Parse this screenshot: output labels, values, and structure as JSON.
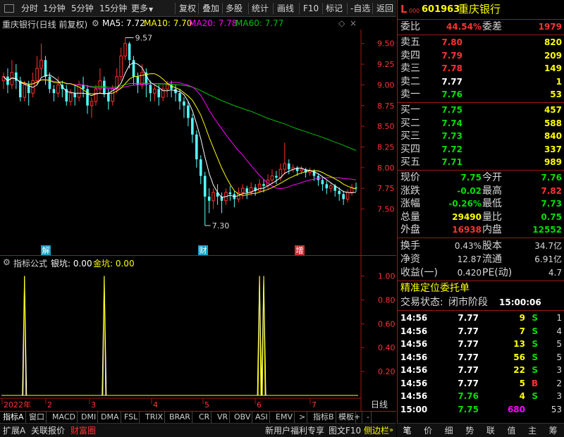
{
  "toolbar": {
    "items": [
      "分时",
      "1分钟",
      "5分钟",
      "15分钟",
      "更多",
      "复权",
      "叠加",
      "多股",
      "统计",
      "画线",
      "F10",
      "标记",
      "-自选",
      "返回"
    ],
    "more_arrow": "▼"
  },
  "chart": {
    "title": "重庆银行(日线 前复权)",
    "ma5": "MA5: 7.72",
    "ma10": "MA10: 7.70",
    "ma20": "MA20: 7.78",
    "ma60": "MA60: 7.77",
    "colors": {
      "ma5": "#ffffff",
      "ma10": "#ffff00",
      "ma20": "#ff00ff",
      "ma60": "#00c000",
      "up": "#ff3232",
      "down": "#54ffff"
    },
    "price_labels": [
      "9.50",
      "9.25",
      "9.00",
      "8.75",
      "8.50",
      "8.25",
      "8.00",
      "7.75",
      "7.50"
    ],
    "high_mark": "9.57",
    "low_mark": "7.30",
    "markers": [
      "解",
      "财",
      "增"
    ]
  },
  "chart_data": {
    "type": "candlestick",
    "ylim": [
      7.3,
      9.6
    ],
    "candles": [
      [
        9.05,
        9.1,
        8.95,
        9.15
      ],
      [
        9.1,
        9.0,
        8.9,
        9.2
      ],
      [
        9.0,
        9.15,
        8.95,
        9.3
      ],
      [
        9.15,
        9.05,
        8.95,
        9.25
      ],
      [
        9.05,
        8.85,
        8.8,
        9.1
      ],
      [
        8.85,
        9.0,
        8.8,
        9.05
      ],
      [
        9.0,
        8.9,
        8.75,
        9.05
      ],
      [
        8.9,
        9.05,
        8.85,
        9.15
      ],
      [
        9.05,
        9.2,
        9.0,
        9.35
      ],
      [
        9.2,
        9.3,
        9.1,
        9.5
      ],
      [
        9.3,
        9.1,
        9.0,
        9.35
      ],
      [
        9.1,
        8.95,
        8.9,
        9.15
      ],
      [
        8.95,
        8.9,
        8.8,
        9.0
      ],
      [
        8.9,
        9.0,
        8.85,
        9.1
      ],
      [
        9.0,
        8.95,
        8.85,
        9.05
      ],
      [
        8.95,
        8.8,
        8.75,
        9.0
      ],
      [
        8.8,
        8.9,
        8.75,
        8.95
      ],
      [
        8.9,
        8.85,
        8.75,
        9.0
      ],
      [
        8.85,
        9.0,
        8.8,
        9.05
      ],
      [
        9.0,
        8.95,
        8.85,
        9.1
      ],
      [
        8.95,
        8.75,
        8.65,
        9.0
      ],
      [
        8.75,
        8.8,
        8.6,
        8.85
      ],
      [
        8.8,
        8.95,
        8.75,
        9.0
      ],
      [
        8.95,
        9.05,
        8.9,
        9.2
      ],
      [
        9.05,
        8.9,
        8.85,
        9.1
      ],
      [
        8.9,
        8.8,
        8.7,
        8.95
      ],
      [
        8.8,
        8.95,
        8.75,
        9.0
      ],
      [
        8.95,
        9.1,
        8.9,
        9.2
      ],
      [
        9.1,
        9.35,
        9.05,
        9.45
      ],
      [
        9.35,
        9.5,
        9.3,
        9.57
      ],
      [
        9.5,
        9.3,
        9.2,
        9.52
      ],
      [
        9.3,
        9.1,
        9.0,
        9.35
      ],
      [
        9.1,
        9.0,
        8.9,
        9.15
      ],
      [
        9.0,
        9.15,
        8.95,
        9.25
      ],
      [
        9.15,
        9.0,
        8.85,
        9.2
      ],
      [
        9.0,
        8.9,
        8.8,
        9.05
      ],
      [
        8.9,
        8.95,
        8.8,
        9.0
      ],
      [
        8.95,
        8.85,
        8.75,
        9.0
      ],
      [
        8.85,
        8.95,
        8.8,
        9.0
      ],
      [
        8.95,
        9.0,
        8.85,
        9.05
      ],
      [
        9.0,
        8.95,
        8.85,
        9.05
      ],
      [
        8.95,
        8.9,
        8.8,
        9.0
      ],
      [
        8.9,
        8.8,
        8.7,
        8.95
      ],
      [
        8.8,
        8.75,
        8.6,
        8.85
      ],
      [
        8.75,
        8.6,
        8.5,
        8.8
      ],
      [
        8.6,
        8.4,
        8.3,
        8.65
      ],
      [
        8.4,
        8.1,
        8.0,
        8.45
      ],
      [
        8.1,
        7.9,
        7.8,
        8.15
      ],
      [
        7.9,
        7.65,
        7.3,
        7.95
      ],
      [
        7.65,
        7.6,
        7.45,
        7.75
      ],
      [
        7.6,
        7.7,
        7.5,
        7.75
      ],
      [
        7.7,
        7.65,
        7.55,
        7.8
      ],
      [
        7.65,
        7.6,
        7.45,
        7.7
      ],
      [
        7.6,
        7.7,
        7.55,
        7.75
      ],
      [
        7.7,
        7.68,
        7.6,
        7.78
      ],
      [
        7.68,
        7.62,
        7.52,
        7.72
      ],
      [
        7.62,
        7.7,
        7.58,
        7.76
      ],
      [
        7.7,
        7.75,
        7.62,
        7.8
      ],
      [
        7.75,
        7.7,
        7.62,
        7.78
      ],
      [
        7.7,
        7.76,
        7.66,
        7.82
      ],
      [
        7.76,
        7.72,
        7.66,
        7.8
      ],
      [
        7.72,
        7.8,
        7.7,
        7.86
      ],
      [
        7.8,
        7.78,
        7.7,
        7.86
      ],
      [
        7.78,
        7.85,
        7.74,
        7.92
      ],
      [
        7.85,
        7.9,
        7.8,
        7.98
      ],
      [
        7.9,
        7.88,
        7.8,
        7.96
      ],
      [
        7.88,
        7.98,
        7.84,
        8.05
      ],
      [
        7.98,
        8.05,
        7.92,
        8.3
      ],
      [
        8.05,
        7.98,
        7.92,
        8.1
      ],
      [
        7.98,
        8.0,
        7.94,
        8.04
      ],
      [
        8.0,
        7.96,
        7.9,
        8.02
      ],
      [
        7.96,
        7.98,
        7.92,
        8.02
      ],
      [
        7.98,
        7.94,
        7.88,
        8.0
      ],
      [
        7.94,
        7.96,
        7.9,
        8.0
      ],
      [
        7.96,
        7.9,
        7.84,
        7.98
      ],
      [
        7.9,
        7.85,
        7.78,
        7.92
      ],
      [
        7.85,
        7.8,
        7.72,
        7.88
      ],
      [
        7.8,
        7.75,
        7.68,
        7.84
      ],
      [
        7.75,
        7.78,
        7.7,
        7.82
      ],
      [
        7.78,
        7.72,
        7.65,
        7.8
      ],
      [
        7.72,
        7.68,
        7.6,
        7.76
      ],
      [
        7.68,
        7.62,
        7.55,
        7.72
      ],
      [
        7.62,
        7.7,
        7.58,
        7.74
      ],
      [
        7.7,
        7.76,
        7.66,
        7.8
      ],
      [
        7.76,
        7.75,
        7.71,
        7.82
      ]
    ],
    "indicator": {
      "name": "银坑",
      "values_hint": "spikes",
      "spikes": [
        5,
        24,
        61,
        62
      ],
      "ylim": [
        0,
        1.05
      ],
      "ticks": [
        "1.00",
        "0.80",
        "0.60",
        "0.40",
        "0.20"
      ]
    },
    "x_months": [
      "2022年",
      "2",
      "3",
      "4",
      "5",
      "6",
      "7"
    ]
  },
  "indicator": {
    "label": "指标公式",
    "yinkeng": "银坑: 0.00",
    "jinkeng": "金坑: 0.00",
    "colors": {
      "yin": "#ffffff",
      "jin": "#ffff00"
    }
  },
  "period": "日线",
  "ind_tabs": [
    "指标A",
    "窗口",
    "MACD",
    "DMI",
    "DMA",
    "FSL",
    "TRIX",
    "BRAR",
    "CR",
    "VR",
    "OBV",
    "ASI",
    "EMV",
    "指标B",
    "模板",
    "+",
    "-"
  ],
  "status_bar": {
    "left": [
      "扩展A",
      "关联报价",
      "财富圈"
    ],
    "right": [
      "新用户福利专享",
      "图文F10",
      "侧边栏"
    ]
  },
  "quote": {
    "code": "601963",
    "name": "重庆银行",
    "l_mark": "L",
    "l_sub": "000",
    "weibi_label": "委比",
    "weibi": "44.54%",
    "weicha_label": "委差",
    "weicha": "1979",
    "asks": [
      {
        "label": "卖五",
        "price": "7.80",
        "vol": "820"
      },
      {
        "label": "卖四",
        "price": "7.79",
        "vol": "209"
      },
      {
        "label": "卖三",
        "price": "7.78",
        "vol": "149"
      },
      {
        "label": "卖二",
        "price": "7.77",
        "vol": "1"
      },
      {
        "label": "卖一",
        "price": "7.76",
        "vol": "53"
      }
    ],
    "bids": [
      {
        "label": "买一",
        "price": "7.75",
        "vol": "457"
      },
      {
        "label": "买二",
        "price": "7.74",
        "vol": "588"
      },
      {
        "label": "买三",
        "price": "7.73",
        "vol": "840"
      },
      {
        "label": "买四",
        "price": "7.72",
        "vol": "337"
      },
      {
        "label": "买五",
        "price": "7.71",
        "vol": "989"
      }
    ],
    "stats": [
      {
        "l1": "现价",
        "v1": "7.75",
        "c1": "#00e000",
        "l2": "今开",
        "v2": "7.76",
        "c2": "#00e000"
      },
      {
        "l1": "涨跌",
        "v1": "-0.02",
        "c1": "#00e000",
        "l2": "最高",
        "v2": "7.82",
        "c2": "#ff3232"
      },
      {
        "l1": "涨幅",
        "v1": "-0.26%",
        "c1": "#00e000",
        "l2": "最低",
        "v2": "7.73",
        "c2": "#00e000"
      },
      {
        "l1": "总量",
        "v1": "29490",
        "c1": "#ffff00",
        "l2": "量比",
        "v2": "0.75",
        "c2": "#00e000"
      },
      {
        "l1": "外盘",
        "v1": "16938",
        "c1": "#ff3232",
        "l2": "内盘",
        "v2": "12552",
        "c2": "#00e000"
      }
    ],
    "fin": [
      {
        "l1": "换手",
        "v1": "0.43%",
        "l2": "股本",
        "v2": "34.7亿"
      },
      {
        "l1": "净资",
        "v1": "12.87",
        "l2": "流通",
        "v2": "6.91亿"
      },
      {
        "l1": "收益(一)",
        "v1": "0.420",
        "l2": "PE(动)",
        "v2": "4.7"
      }
    ],
    "precise_order": "精准定位委托单",
    "trade_status_label": "交易状态:",
    "trade_status": "闭市阶段",
    "trade_time": "15:00:06",
    "ticks": [
      {
        "time": "14:56",
        "price": "7.77",
        "pc": "#ffffff",
        "vol": "9",
        "vc": "#ffff00",
        "side": "S",
        "sc": "#00e000",
        "n": "1"
      },
      {
        "time": "14:56",
        "price": "7.77",
        "pc": "#ffffff",
        "vol": "7",
        "vc": "#ffff00",
        "side": "S",
        "sc": "#00e000",
        "n": "4"
      },
      {
        "time": "14:56",
        "price": "7.77",
        "pc": "#ffffff",
        "vol": "13",
        "vc": "#ffff00",
        "side": "S",
        "sc": "#00e000",
        "n": "5"
      },
      {
        "time": "14:56",
        "price": "7.77",
        "pc": "#ffffff",
        "vol": "56",
        "vc": "#ffff00",
        "side": "S",
        "sc": "#00e000",
        "n": "5"
      },
      {
        "time": "14:56",
        "price": "7.77",
        "pc": "#ffffff",
        "vol": "22",
        "vc": "#ffff00",
        "side": "S",
        "sc": "#00e000",
        "n": "3"
      },
      {
        "time": "14:56",
        "price": "7.77",
        "pc": "#ffffff",
        "vol": "5",
        "vc": "#ffff00",
        "side": "B",
        "sc": "#ff3232",
        "n": "2"
      },
      {
        "time": "14:56",
        "price": "7.76",
        "pc": "#00e000",
        "vol": "4",
        "vc": "#ffff00",
        "side": "S",
        "sc": "#00e000",
        "n": "3"
      },
      {
        "time": "15:00",
        "price": "7.75",
        "pc": "#00e000",
        "vol": "680",
        "vc": "#ff00ff",
        "side": "",
        "sc": "#00e000",
        "n": "53"
      }
    ]
  },
  "rp_tabs": [
    "笔",
    "价",
    "细",
    "势",
    "联",
    "值",
    "主",
    "筹"
  ]
}
